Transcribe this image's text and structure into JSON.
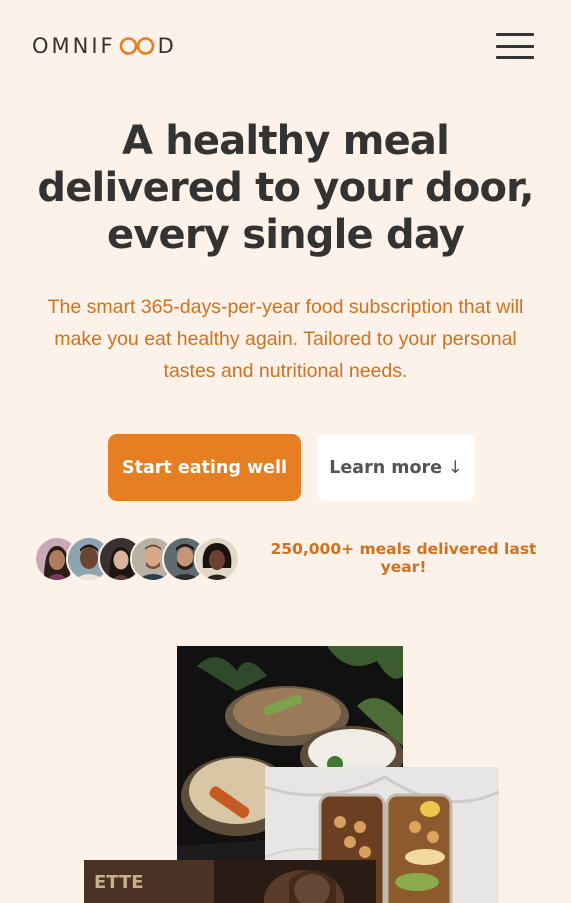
{
  "header": {
    "logo": {
      "left": "OMNIF",
      "right": "D"
    },
    "menu_icon": "hamburger-menu-icon"
  },
  "hero": {
    "title_lines": [
      "A healthy meal",
      "delivered to your door,",
      "every single day"
    ],
    "description": "The smart 365-days-per-year food subscription that will make you eat healthy again. Tailored to your personal tastes and nutritional needs.",
    "cta_primary": "Start eating well",
    "cta_secondary": "Learn more",
    "cta_secondary_arrow": "↓",
    "delivered_text": "250,000+ meals delivered last year!"
  },
  "colors": {
    "background": "#fdf2e9",
    "accent": "#e67e22",
    "accent_dark": "#cf711f",
    "text": "#333333"
  }
}
